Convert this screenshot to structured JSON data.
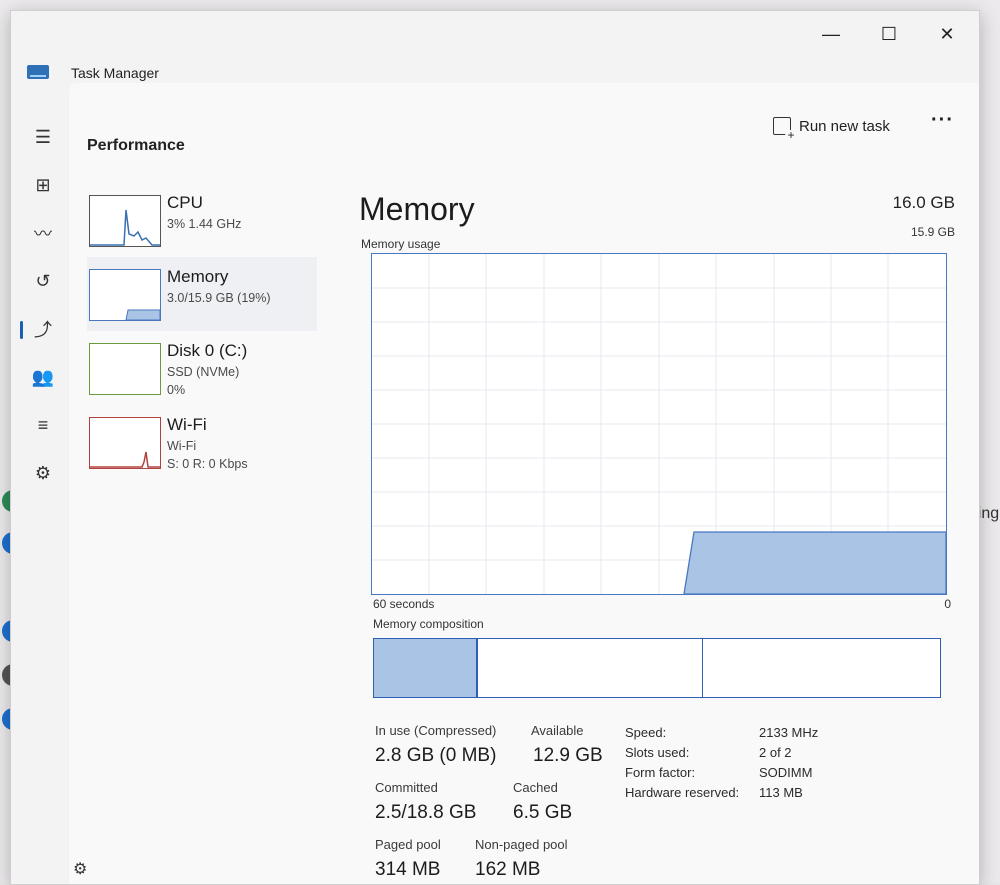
{
  "window": {
    "title": "Task Manager",
    "minimize": "—",
    "maximize": "☐",
    "close": "✕"
  },
  "toolbar": {
    "page_title": "Performance",
    "run_new_task": "Run new task",
    "more": "···"
  },
  "nav": {
    "items": [
      {
        "name": "hamburger-icon",
        "glyph": "☰"
      },
      {
        "name": "processes-icon",
        "glyph": "⊞"
      },
      {
        "name": "performance-icon",
        "glyph": "〰"
      },
      {
        "name": "app-history-icon",
        "glyph": "↺"
      },
      {
        "name": "startup-apps-icon",
        "glyph": "⤴"
      },
      {
        "name": "users-icon",
        "glyph": "👥"
      },
      {
        "name": "details-icon",
        "glyph": "≡"
      },
      {
        "name": "services-icon",
        "glyph": "⚙"
      }
    ],
    "settings": "⚙"
  },
  "perf_list": [
    {
      "name": "CPU",
      "lines": [
        "3% 1.44 GHz"
      ]
    },
    {
      "name": "Memory",
      "lines": [
        "3.0/15.9 GB (19%)"
      ]
    },
    {
      "name": "Disk 0 (C:)",
      "lines": [
        "SSD (NVMe)",
        "0%"
      ]
    },
    {
      "name": "Wi-Fi",
      "lines": [
        "Wi-Fi",
        "S: 0 R: 0 Kbps"
      ]
    }
  ],
  "memory": {
    "title": "Memory",
    "total": "16.0 GB",
    "usage_label": "Memory usage",
    "usage_max": "15.9 GB",
    "axis_left": "60 seconds",
    "axis_right": "0",
    "composition_label": "Memory composition",
    "stats": {
      "in_use_label": "In use (Compressed)",
      "in_use_value": "2.8 GB (0 MB)",
      "available_label": "Available",
      "available_value": "12.9 GB",
      "committed_label": "Committed",
      "committed_value": "2.5/18.8 GB",
      "cached_label": "Cached",
      "cached_value": "6.5 GB",
      "paged_label": "Paged pool",
      "paged_value": "314 MB",
      "nonpaged_label": "Non-paged pool",
      "nonpaged_value": "162 MB"
    },
    "details": [
      {
        "label": "Speed:",
        "value": "2133 MHz"
      },
      {
        "label": "Slots used:",
        "value": "2 of 2"
      },
      {
        "label": "Form factor:",
        "value": "SODIMM"
      },
      {
        "label": "Hardware reserved:",
        "value": "113 MB"
      }
    ]
  },
  "background": {
    "settings_fragment": "etting"
  },
  "colors": {
    "accent": "#1a5fb4",
    "memory_line": "#4a78c0",
    "memory_fill": "#a9c4e4",
    "network": "#b0413e"
  }
}
